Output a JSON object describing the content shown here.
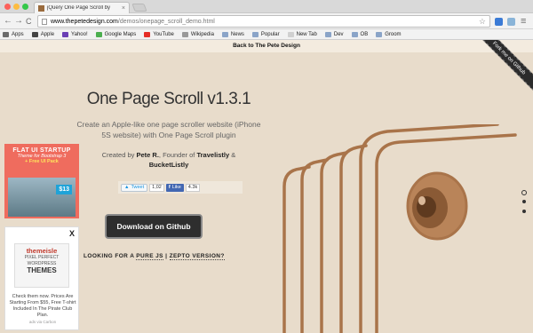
{
  "browser": {
    "tab_title": "jQuery One Page Scroll by",
    "tab_close": "×",
    "url_host": "www.thepetedesign.com",
    "url_path": "/demos/onepage_scroll_demo.html",
    "back_icon": "←",
    "forward_icon": "→",
    "reload_icon": "C",
    "star_icon": "☆",
    "menu_icon": "≡"
  },
  "bookmarks": [
    {
      "label": "Apps",
      "color": "#6b6b6b"
    },
    {
      "label": "Apple",
      "color": "#444444"
    },
    {
      "label": "Yahoo!",
      "color": "#6a3fb5"
    },
    {
      "label": "Google Maps",
      "color": "#4caf50"
    },
    {
      "label": "YouTube",
      "color": "#e52d27"
    },
    {
      "label": "Wikipedia",
      "color": "#999999"
    },
    {
      "label": "News",
      "color": "#8aa4c8"
    },
    {
      "label": "Popular",
      "color": "#8aa4c8"
    },
    {
      "label": "New Tab",
      "color": "#d0d0d0"
    },
    {
      "label": "Dev",
      "color": "#8aa4c8"
    },
    {
      "label": "OB",
      "color": "#8aa4c8"
    },
    {
      "label": "Groom",
      "color": "#8aa4c8"
    }
  ],
  "page": {
    "back_link": "Back to The Pete Design",
    "ribbon": "Fork me on Github",
    "title": "One Page Scroll v1.3.1",
    "subtitle": "Create an Apple-like one page scroller website (iPhone 5S website) with One Page Scroll plugin",
    "credits_prefix": "Created by",
    "author": "Pete R.",
    "credits_mid": ", Founder of",
    "company1": "Travelistly",
    "credits_and": "&",
    "company2": "BucketListly",
    "tweet_label": "Tweet",
    "tweet_count": "1,02",
    "like_label": "Like",
    "like_count": "4.3k",
    "download_button": "Download on Github",
    "looking_prefix": "LOOKING FOR A",
    "pure_js": "PURE JS",
    "separator": "|",
    "zepto": "ZEPTO VERSION?"
  },
  "ad1": {
    "headline": "FLAT UI STARTUP",
    "sub": "Theme for Bootstrap 3",
    "free": "+ Free UI Pack",
    "price": "$13"
  },
  "ad2": {
    "close": "X",
    "brand": "themeisle",
    "line1": "PIXEL PERFECT",
    "line2": "WORDPRESS",
    "themes": "THEMES",
    "copy": "Check them now. Prices Are Starting From $55, Free T-shirt Included In The Pirate Club Plan.",
    "via": "ads via Carbon"
  },
  "colors": {
    "background": "#e8dccb",
    "phone_stroke": "#a9744a",
    "lens": "#8a5a35"
  }
}
